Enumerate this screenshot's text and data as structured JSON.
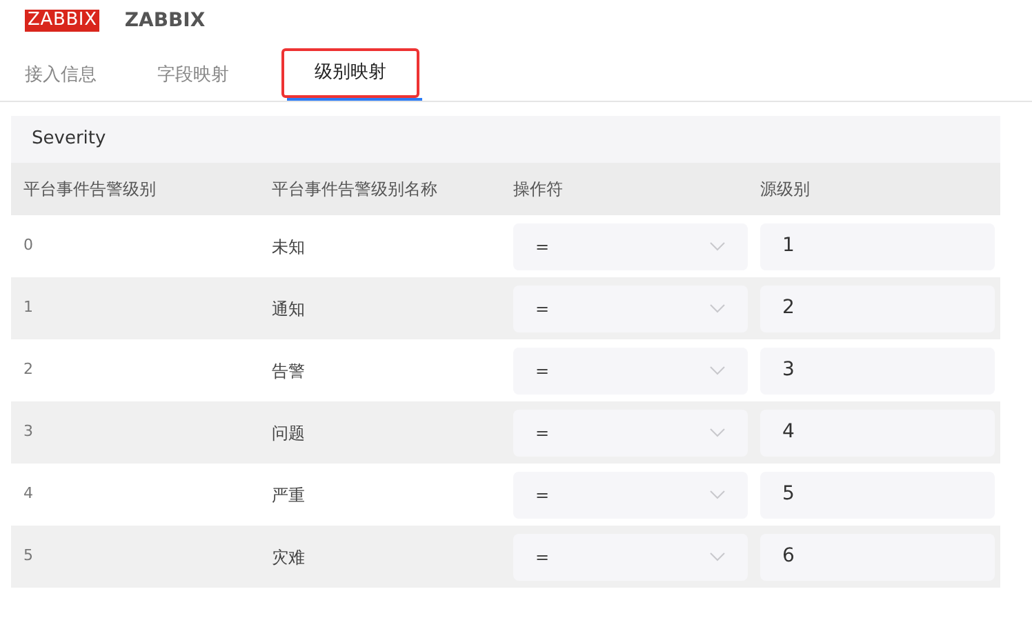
{
  "header": {
    "logo": "ZABBIX",
    "title": "ZABBIX"
  },
  "tabs": [
    {
      "label": "接入信息",
      "selected": false
    },
    {
      "label": "字段映射",
      "selected": false
    },
    {
      "label": "级别映射",
      "selected": true
    }
  ],
  "section": {
    "title": "Severity"
  },
  "table": {
    "columns": [
      "平台事件告警级别",
      "平台事件告警级别名称",
      "操作符",
      "源级别"
    ],
    "rows": [
      {
        "level": "0",
        "name": "未知",
        "operator": "=",
        "source": "1"
      },
      {
        "level": "1",
        "name": "通知",
        "operator": "=",
        "source": "2"
      },
      {
        "level": "2",
        "name": "告警",
        "operator": "=",
        "source": "3"
      },
      {
        "level": "3",
        "name": "问题",
        "operator": "=",
        "source": "4"
      },
      {
        "level": "4",
        "name": "严重",
        "operator": "=",
        "source": "5"
      },
      {
        "level": "5",
        "name": "灾难",
        "operator": "=",
        "source": "6"
      }
    ]
  }
}
